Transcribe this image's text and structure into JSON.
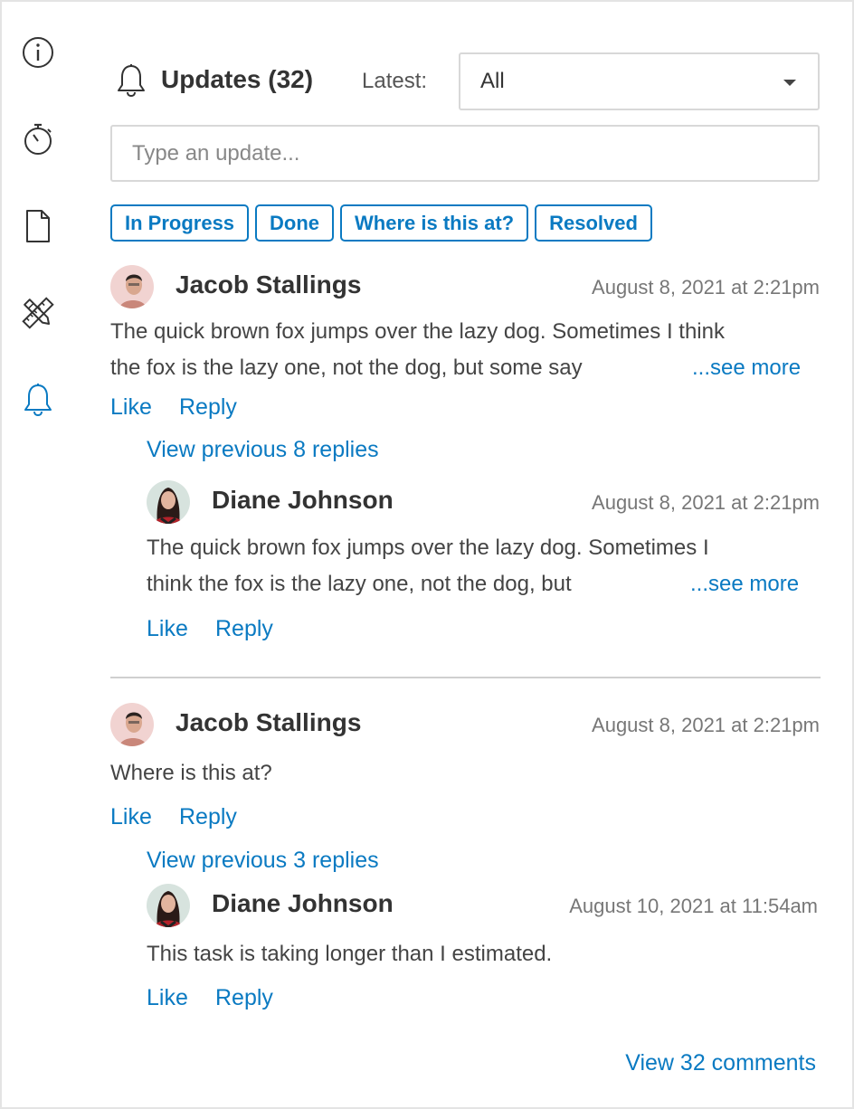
{
  "rail": {
    "icons": [
      "info-icon",
      "stopwatch-icon",
      "document-icon",
      "pencil-ruler-icon",
      "bell-icon"
    ],
    "active_icon": "bell-icon"
  },
  "header": {
    "title": "Updates (32)",
    "latest_label": "Latest:",
    "filter_value": "All"
  },
  "update_input": {
    "placeholder": "Type an update...",
    "value": ""
  },
  "chips": [
    "In Progress",
    "Done",
    "Where is this at?",
    "Resolved"
  ],
  "threads": [
    {
      "author": "Jacob Stallings",
      "timestamp": "August 8, 2021 at 2:21pm",
      "line1": "The quick brown fox jumps over the lazy dog. Sometimes I think",
      "line2": "the fox is the lazy one, not the dog, but some say",
      "see_more": "...see more",
      "like": "Like",
      "reply": "Reply",
      "view_previous": "View previous 8 replies",
      "reply_item": {
        "author": "Diane Johnson",
        "timestamp": "August 8, 2021 at 2:21pm",
        "line1": "The quick brown fox jumps over the lazy dog. Sometimes I",
        "line2": "think the fox is the lazy one, not the dog, but",
        "see_more": "...see more",
        "like": "Like",
        "reply": "Reply"
      }
    },
    {
      "author": "Jacob Stallings",
      "timestamp": "August 8, 2021 at 2:21pm",
      "line1": "Where is this at?",
      "like": "Like",
      "reply": "Reply",
      "view_previous": "View previous 3 replies",
      "reply_item": {
        "author": "Diane Johnson",
        "timestamp": "August 10, 2021 at 11:54am",
        "line1": "This task is taking longer than I estimated.",
        "like": "Like",
        "reply": "Reply"
      }
    }
  ],
  "footer": {
    "view_all": "View 32 comments"
  },
  "colors": {
    "accent": "#0a7ac2",
    "text": "#333333",
    "muted": "#777777",
    "border": "#d8d8d8"
  }
}
